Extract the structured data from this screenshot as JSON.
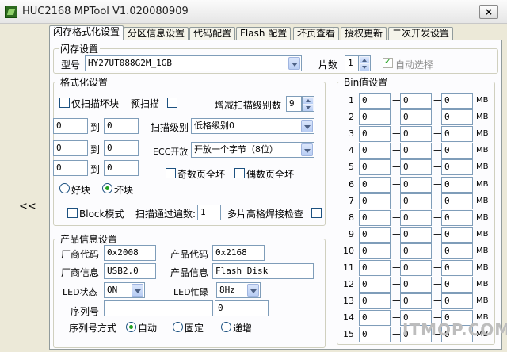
{
  "window": {
    "title": "HUC2168 MPTool V1.020080909",
    "close_label": "×",
    "collapse_label": "<<"
  },
  "tabs": [
    "闪存格式化设置",
    "分区信息设置",
    "代码配置",
    "Flash 配置",
    "坏页查看",
    "授权更新",
    "二次开发设置"
  ],
  "flash": {
    "legend": "闪存设置",
    "model_label": "型号",
    "model_value": "HY27UT088G2M_1GB",
    "chips_label": "片数",
    "chips_value": "1",
    "auto_select_label": "自动选择"
  },
  "format": {
    "legend": "格式化设置",
    "scan_bad_only_label": "仅扫描坏块",
    "prescan_label": "预扫描",
    "increase_scan_level_label": "增减扫描级别数",
    "increase_scan_level_value": "9",
    "to_label": "到",
    "ranges": [
      [
        "0",
        "0"
      ],
      [
        "0",
        "0"
      ],
      [
        "0",
        "0"
      ]
    ],
    "scan_level_label": "扫描级别",
    "scan_level_value": "低格级别0",
    "ecc_label": "ECC开放",
    "ecc_value": "开放一个字节（8位）",
    "odd_full_bad_label": "奇数页全坏",
    "even_full_bad_label": "偶数页全坏",
    "good_block_label": "好块",
    "bad_block_label": "坏块",
    "block_mode_label": "Block模式",
    "scan_pass_label": "扫描通过遍数:",
    "scan_pass_value": "1",
    "multi_chip_check_label": "多片高格焊接检查"
  },
  "product": {
    "legend": "产品信息设置",
    "vendor_code_label": "厂商代码",
    "vendor_code_value": "0x2008",
    "product_code_label": "产品代码",
    "product_code_value": "0x2168",
    "vendor_info_label": "厂商信息",
    "vendor_info_value": "USB2.0",
    "product_info_label": "产品信息",
    "product_info_value": "Flash Disk",
    "led_state_label": "LED状态",
    "led_state_value": "ON",
    "led_busy_label": "LED忙碌",
    "led_busy_value": "8Hz",
    "serial_label": "序列号",
    "serial_value": "",
    "serial_num_value": "0",
    "serial_mode_label": "序列号方式",
    "serial_modes": [
      "自动",
      "固定",
      "递增"
    ]
  },
  "bin": {
    "legend": "Bin值设置",
    "dash": "—",
    "unit": "MB",
    "rows": [
      "1",
      "2",
      "3",
      "4",
      "5",
      "6",
      "7",
      "8",
      "9",
      "10",
      "11",
      "12",
      "13",
      "14",
      "15"
    ],
    "value": "0"
  },
  "watermark": "ITMOP.COM",
  "colors": {
    "frame": "#ece9d8",
    "panel": "#fcfcfe",
    "field_border": "#7f9db9",
    "check_green": "#21a121"
  }
}
